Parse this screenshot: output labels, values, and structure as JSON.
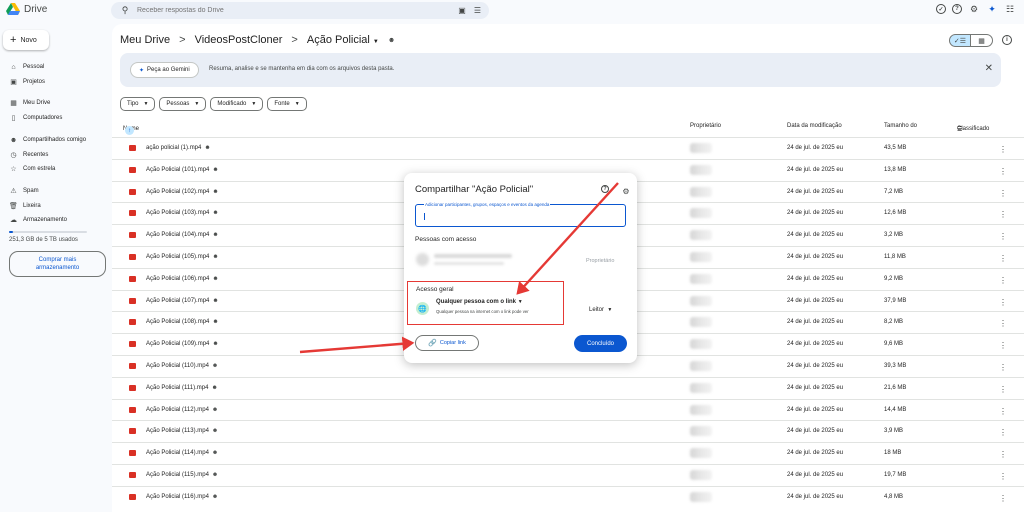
{
  "app": {
    "name": "Drive"
  },
  "search": {
    "placeholder": "Receber respostas do Drive"
  },
  "sidebar": {
    "new_label": "Novo",
    "items": [
      {
        "label": "Pessoal",
        "icon": "home-icon"
      },
      {
        "label": "Projetos",
        "icon": "projects-icon"
      },
      {
        "label": "Meu Drive",
        "icon": "drive-icon"
      },
      {
        "label": "Computadores",
        "icon": "computer-icon"
      },
      {
        "label": "Compartilhados comigo",
        "icon": "people-icon"
      },
      {
        "label": "Recentes",
        "icon": "clock-icon"
      },
      {
        "label": "Com estrela",
        "icon": "star-icon"
      },
      {
        "label": "Spam",
        "icon": "spam-icon"
      },
      {
        "label": "Lixeira",
        "icon": "trash-icon"
      },
      {
        "label": "Armazenamento",
        "icon": "cloud-icon"
      }
    ],
    "storage_text": "251,3 GB de 5 TB usados",
    "storage_fraction": 0.05,
    "buy_label": "Comprar mais armazenamento"
  },
  "breadcrumb": {
    "items": [
      "Meu Drive",
      "VideosPostCloner",
      "Ação Policial"
    ],
    "separator": ">"
  },
  "gemini": {
    "button_label": "Peça ao Gemini",
    "text": "Resuma, analise e se mantenha em dia com os arquivos desta pasta."
  },
  "filters": [
    "Tipo",
    "Pessoas",
    "Modificado",
    "Fonte"
  ],
  "table": {
    "headers": {
      "name": "Nome",
      "owner": "Proprietário",
      "modified": "Data da modificação",
      "size": "Tamanho do",
      "sort": "Classificado"
    },
    "rows": [
      {
        "name": "ação policial (1).mp4",
        "modified": "24 de jul. de 2025 eu",
        "size": "43,5 MB"
      },
      {
        "name": "Ação Policial (101).mp4",
        "modified": "24 de jul. de 2025 eu",
        "size": "13,8 MB"
      },
      {
        "name": "Ação Policial (102).mp4",
        "modified": "24 de jul. de 2025 eu",
        "size": "7,2 MB"
      },
      {
        "name": "Ação Policial (103).mp4",
        "modified": "24 de jul. de 2025 eu",
        "size": "12,6 MB"
      },
      {
        "name": "Ação Policial (104).mp4",
        "modified": "24 de jul. de 2025 eu",
        "size": "3,2 MB"
      },
      {
        "name": "Ação Policial (105).mp4",
        "modified": "24 de jul. de 2025 eu",
        "size": "11,8 MB"
      },
      {
        "name": "Ação Policial (106).mp4",
        "modified": "24 de jul. de 2025 eu",
        "size": "9,2 MB"
      },
      {
        "name": "Ação Policial (107).mp4",
        "modified": "24 de jul. de 2025 eu",
        "size": "37,9 MB"
      },
      {
        "name": "Ação Policial (108).mp4",
        "modified": "24 de jul. de 2025 eu",
        "size": "8,2 MB"
      },
      {
        "name": "Ação Policial (109).mp4",
        "modified": "24 de jul. de 2025 eu",
        "size": "9,6 MB"
      },
      {
        "name": "Ação Policial (110).mp4",
        "modified": "24 de jul. de 2025 eu",
        "size": "39,3 MB"
      },
      {
        "name": "Ação Policial (111).mp4",
        "modified": "24 de jul. de 2025 eu",
        "size": "21,6 MB"
      },
      {
        "name": "Ação Policial (112).mp4",
        "modified": "24 de jul. de 2025 eu",
        "size": "14,4 MB"
      },
      {
        "name": "Ação Policial (113).mp4",
        "modified": "24 de jul. de 2025 eu",
        "size": "3,9 MB"
      },
      {
        "name": "Ação Policial (114).mp4",
        "modified": "24 de jul. de 2025 eu",
        "size": "18 MB"
      },
      {
        "name": "Ação Policial (115).mp4",
        "modified": "24 de jul. de 2025 eu",
        "size": "19,7 MB"
      },
      {
        "name": "Ação Policial (116).mp4",
        "modified": "24 de jul. de 2025 eu",
        "size": "4,8 MB"
      }
    ]
  },
  "dialog": {
    "title": "Compartilhar \"Ação Policial\"",
    "input_label": "Adicionar participantes, grupos, espaços e eventos da agenda",
    "people_title": "Pessoas com acesso",
    "owner_role": "Proprietário",
    "general_title": "Acesso geral",
    "access_value": "Qualquer pessoa com o link",
    "access_desc": "Qualquer pessoa na internet com o link pode ver",
    "role_value": "Leitor",
    "copy_label": "Copiar link",
    "done_label": "Concluído"
  },
  "colors": {
    "accent": "#0b57d0",
    "highlight": "#e53935",
    "video": "#d93025"
  }
}
